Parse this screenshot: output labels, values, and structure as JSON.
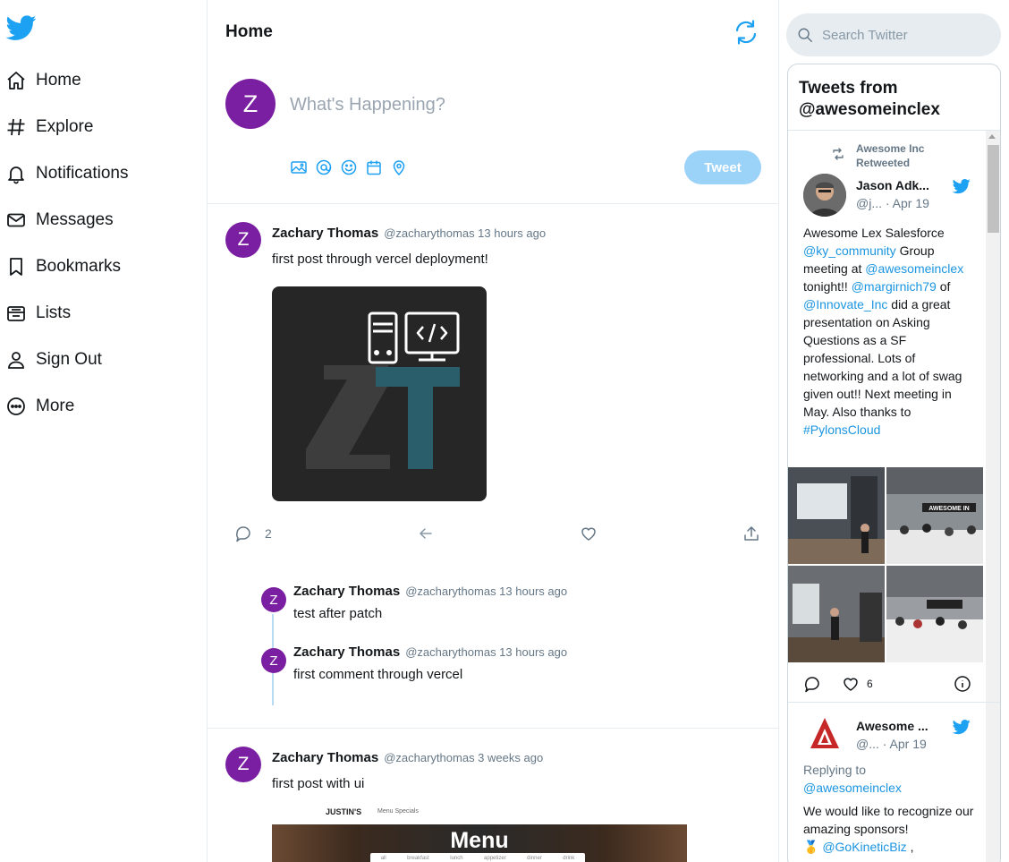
{
  "sidebar": {
    "items": [
      {
        "label": "Home",
        "icon": "home-icon"
      },
      {
        "label": "Explore",
        "icon": "hashtag-icon"
      },
      {
        "label": "Notifications",
        "icon": "bell-icon"
      },
      {
        "label": "Messages",
        "icon": "mail-icon"
      },
      {
        "label": "Bookmarks",
        "icon": "bookmark-icon"
      },
      {
        "label": "Lists",
        "icon": "list-icon"
      },
      {
        "label": "Sign Out",
        "icon": "user-icon"
      },
      {
        "label": "More",
        "icon": "more-icon"
      }
    ]
  },
  "header": {
    "title": "Home"
  },
  "compose": {
    "avatar_letter": "Z",
    "placeholder": "What's Happening?",
    "button_label": "Tweet"
  },
  "posts": [
    {
      "avatar_letter": "Z",
      "name": "Zachary Thomas",
      "meta": "@zacharythomas 13 hours ago",
      "text": "first post through vercel deployment!",
      "reply_count": "2",
      "image_letters": "ZT"
    },
    {
      "avatar_letter": "Z",
      "name": "Zachary Thomas",
      "meta": "@zacharythomas 3 weeks ago",
      "text": "first post with ui",
      "image_brand": "JUSTIN'S",
      "image_subtitle": "Menu Specials",
      "image_title": "Menu",
      "image_menu": [
        "all",
        "breakfast",
        "lunch",
        "appetizer",
        "dinner",
        "drink"
      ]
    }
  ],
  "replies": [
    {
      "avatar_letter": "Z",
      "name": "Zachary Thomas",
      "meta": "@zacharythomas 13 hours ago",
      "text": "test after patch"
    },
    {
      "avatar_letter": "Z",
      "name": "Zachary Thomas",
      "meta": "@zacharythomas 13 hours ago",
      "text": "first comment through vercel"
    }
  ],
  "search": {
    "placeholder": "Search Twitter"
  },
  "timeline": {
    "title": "Tweets from @awesomeinclex",
    "tweet1": {
      "retweet_label": "Awesome Inc Retweeted",
      "name": "Jason Adk...",
      "handle": "@j...",
      "date": "· Apr 19",
      "body": [
        {
          "t": "Awesome Lex Salesforce "
        },
        {
          "t": "@ky_community",
          "link": true
        },
        {
          "t": "  Group meeting  at "
        },
        {
          "t": "@awesomeinclex",
          "link": true
        },
        {
          "t": " tonight!! "
        },
        {
          "t": "@margirnich79",
          "link": true
        },
        {
          "t": " of "
        },
        {
          "t": "@Innovate_Inc",
          "link": true
        },
        {
          "t": " did a great presentation  on Asking Questions as a SF professional. Lots of networking and a lot of swag given out!! Next meeting in May. Also thanks to "
        },
        {
          "t": "#PylonsCloud",
          "link": true
        }
      ],
      "photo_sign": "AWESOME IN",
      "like_count": "6"
    },
    "tweet2": {
      "name": "Awesome ...",
      "handle": "@...",
      "date": "· Apr 19",
      "replying_label": "Replying to",
      "replying_handle": "@awesomeinclex",
      "body_text": "We would like to recognize our amazing sponsors!",
      "medal": "🥇",
      "sponsor": "@GoKineticBiz",
      "sponsor_suffix": " ,"
    }
  },
  "colors": {
    "accent": "#1da1f2",
    "avatar": "#7b1fa2",
    "tweet_button": "#9bd2f7",
    "link": "#1b95e0"
  }
}
